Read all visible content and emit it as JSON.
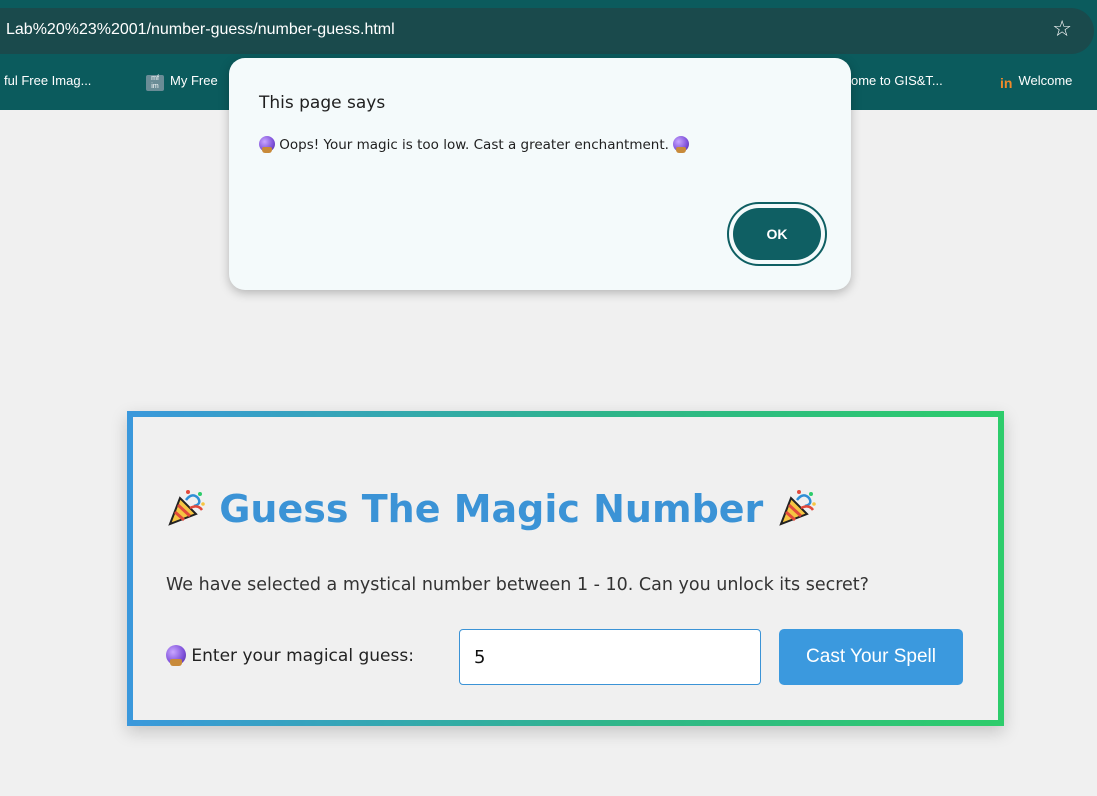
{
  "browser": {
    "url": "Lab%20%23%2001/number-guess/number-guess.html",
    "star_icon": "star-icon",
    "bookmarks": [
      {
        "label": "ful Free Imag...",
        "icon": ""
      },
      {
        "label": "My Free",
        "icon": "mf-im-icon"
      },
      {
        "label": "ome to GIS&T...",
        "icon": ""
      },
      {
        "label": "Welcome",
        "icon": "in-icon"
      }
    ]
  },
  "dialog": {
    "title": "This page says",
    "message": "Oops! Your magic is too low. Cast a greater enchantment.",
    "ok_label": "OK",
    "accent": "#0f5f63"
  },
  "game": {
    "title": "Guess The Magic Number",
    "description": "We have selected a mystical number between 1 - 10. Can you unlock its secret?",
    "input_label": "Enter your magical guess:",
    "input_value": "5",
    "button_label": "Cast Your Spell",
    "colors": {
      "title": "#3b93d6",
      "button": "#3b99de",
      "border_start": "#3a98dc",
      "border_end": "#2dcc6b"
    }
  }
}
